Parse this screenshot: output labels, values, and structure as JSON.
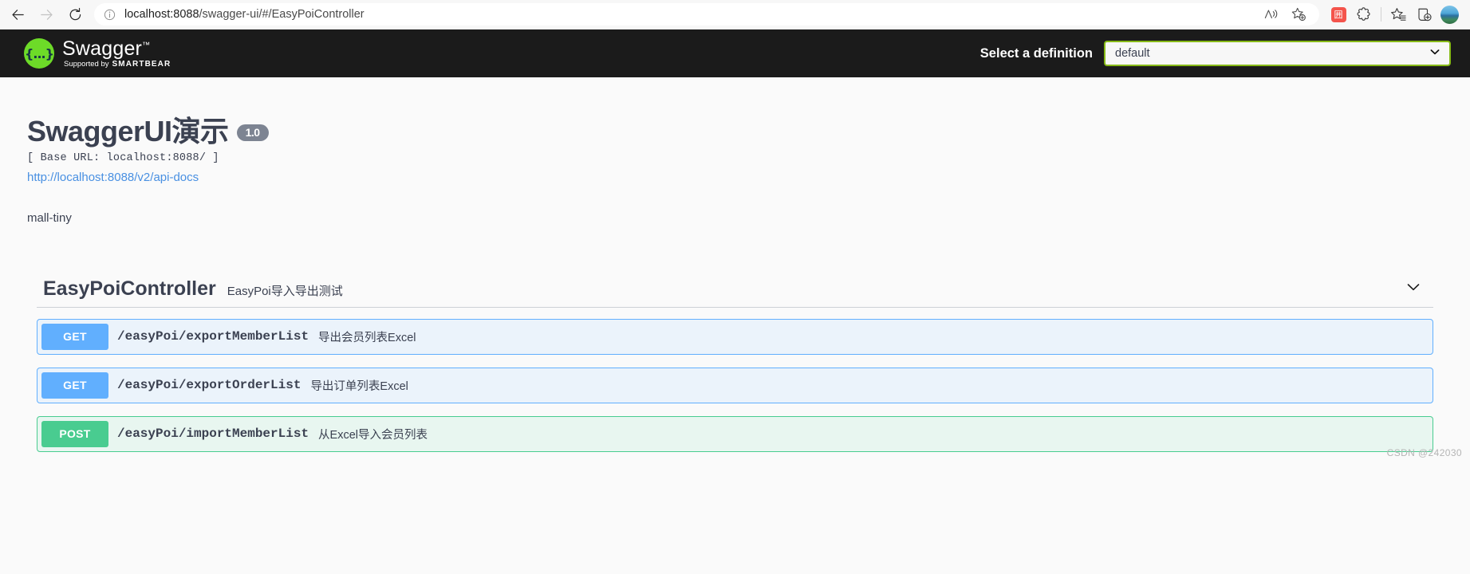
{
  "browser": {
    "back_icon": "arrow-left-icon",
    "forward_icon": "arrow-right-icon",
    "reload_icon": "reload-icon",
    "site_info_icon": "info-circle-icon",
    "url_host": "localhost:8088",
    "url_path": "/swagger-ui/#/EasyPoiController",
    "url_full": "localhost:8088/swagger-ui/#/EasyPoiController",
    "toolbar_icons": [
      {
        "name": "read-aloud-icon",
        "glyph": "A"
      },
      {
        "name": "add-favorite-icon",
        "glyph": "☆"
      },
      {
        "name": "extension-red-icon",
        "glyph": "囲"
      },
      {
        "name": "extensions-icon",
        "glyph": "✣"
      },
      {
        "name": "favorites-icon",
        "glyph": "☆"
      },
      {
        "name": "collections-icon",
        "glyph": "⊞"
      },
      {
        "name": "profile-avatar",
        "glyph": ""
      }
    ]
  },
  "topbar": {
    "logo_glyph": "{...}",
    "logo_text": "Swagger",
    "logo_tm": "™",
    "supported_by": "Supported by",
    "smartbear": "SMARTBEAR",
    "select_definition_label": "Select a definition",
    "definition_value": "default",
    "definition_options": [
      "default"
    ],
    "chevron_icon": "chevron-down-icon",
    "background_color": "#1b1b1b",
    "accent_green": "#86b916"
  },
  "info": {
    "title": "SwaggerUI演示",
    "version": "1.0",
    "base_url": "[ Base URL: localhost:8088/ ]",
    "api_docs_url": "http://localhost:8088/v2/api-docs",
    "description": "mall-tiny"
  },
  "tag": {
    "name": "EasyPoiController",
    "description": "EasyPoi导入导出测试",
    "toggle_icon": "chevron-down-icon",
    "operations": [
      {
        "method": "GET",
        "path": "/easyPoi/exportMemberList",
        "summary": "导出会员列表Excel",
        "color": "#61affe"
      },
      {
        "method": "GET",
        "path": "/easyPoi/exportOrderList",
        "summary": "导出订单列表Excel",
        "color": "#61affe"
      },
      {
        "method": "POST",
        "path": "/easyPoi/importMemberList",
        "summary": "从Excel导入会员列表",
        "color": "#49cc90"
      }
    ]
  },
  "watermark": "CSDN @242030"
}
